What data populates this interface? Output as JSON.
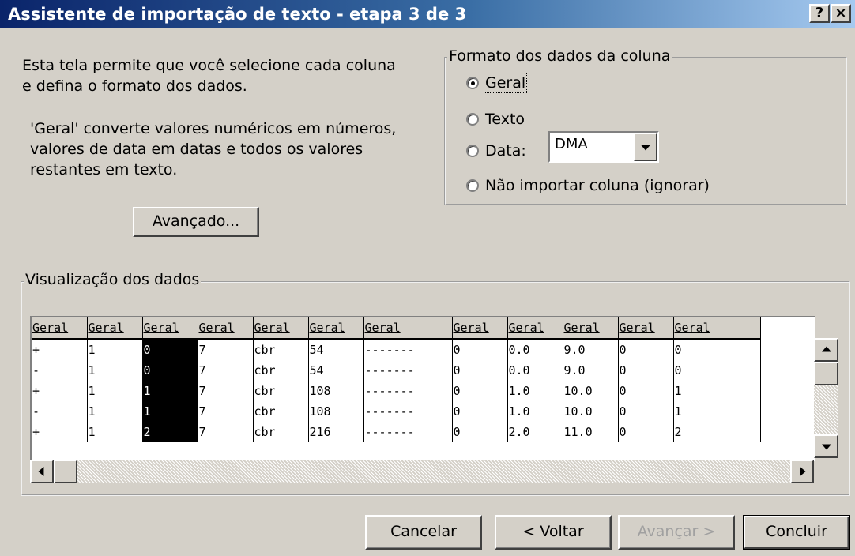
{
  "window": {
    "title": "Assistente de importação de texto - etapa 3 de 3",
    "help_btn": "?",
    "close_btn": "×"
  },
  "description": {
    "line1": "Esta tela permite que você selecione cada coluna\ne defina o formato dos dados.",
    "line2": "'Geral' converte valores numéricos em números,\nvalores de data em datas e todos os valores\nrestantes em texto."
  },
  "advanced_button": "Avançado...",
  "format_group": {
    "legend": "Formato dos dados da coluna",
    "options": [
      {
        "label": "Geral",
        "checked": true
      },
      {
        "label": "Texto",
        "checked": false
      },
      {
        "label": "Data:",
        "checked": false
      },
      {
        "label": "Não importar coluna (ignorar)",
        "checked": false
      }
    ],
    "date_format": "DMA"
  },
  "preview": {
    "legend": "Visualização dos dados",
    "headers": [
      "Geral",
      "Geral",
      "Geral",
      "Geral",
      "Geral",
      "Geral",
      "Geral",
      "Geral",
      "Geral",
      "Geral",
      "Geral",
      "Geral"
    ],
    "rows": [
      [
        "+",
        "1",
        "0",
        "7",
        "cbr",
        "54",
        "-------",
        "0",
        "0.0",
        "9.0",
        "0",
        "0"
      ],
      [
        "-",
        "1",
        "0",
        "7",
        "cbr",
        "54",
        "-------",
        "0",
        "0.0",
        "9.0",
        "0",
        "0"
      ],
      [
        "+",
        "1",
        "1",
        "7",
        "cbr",
        "108",
        "-------",
        "0",
        "1.0",
        "10.0",
        "0",
        "1"
      ],
      [
        "-",
        "1",
        "1",
        "7",
        "cbr",
        "108",
        "-------",
        "0",
        "1.0",
        "10.0",
        "0",
        "1"
      ],
      [
        "+",
        "1",
        "2",
        "7",
        "cbr",
        "216",
        "-------",
        "0",
        "2.0",
        "11.0",
        "0",
        "2"
      ]
    ],
    "selected_column": 2
  },
  "buttons": {
    "cancel": "Cancelar",
    "back": "< Voltar",
    "next": "Avançar >",
    "finish": "Concluir"
  }
}
